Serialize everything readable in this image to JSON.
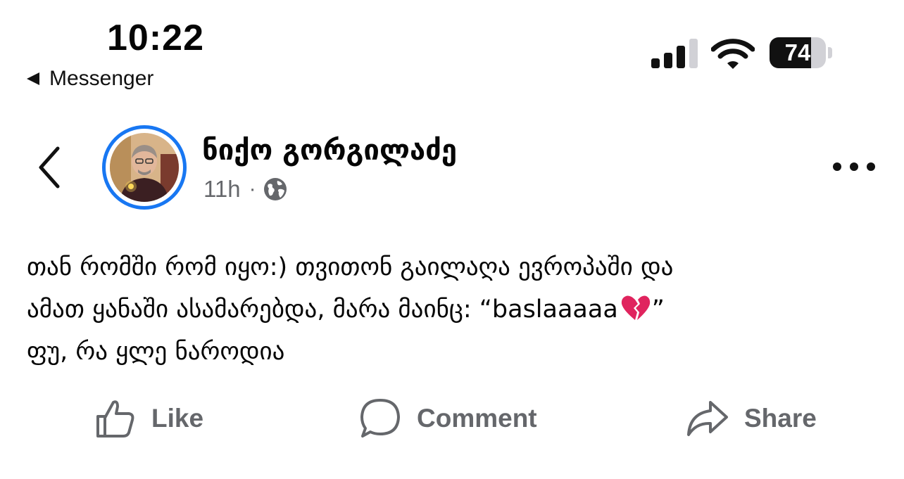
{
  "status_bar": {
    "time": "10:22",
    "back_app_label": "Messenger",
    "battery_level": "74",
    "battery_fraction": 0.74,
    "signal_bars_filled": 3,
    "signal_bars_total": 4
  },
  "post": {
    "author": "ნიქო გორგილაძე",
    "time_ago": "11h",
    "separator": "·",
    "privacy_icon": "globe-icon",
    "text_lines": {
      "line1": "თან რომში რომ იყო:) თვითონ გაილაღა ევროპაში და",
      "line2_before": "ამათ ყანაში ასამარებდა, მარა მაინც: “baslaaaaa",
      "line2_emoji": "broken-heart-emoji",
      "line2_after": "”",
      "line3": "ფუ, რა ყლე ნაროდია"
    }
  },
  "actions": {
    "like_label": "Like",
    "comment_label": "Comment",
    "share_label": "Share"
  },
  "colors": {
    "accent_ring": "#1877f2",
    "secondary_text": "#65676b",
    "primary_text": "#050505",
    "heart": "#e0245e"
  }
}
